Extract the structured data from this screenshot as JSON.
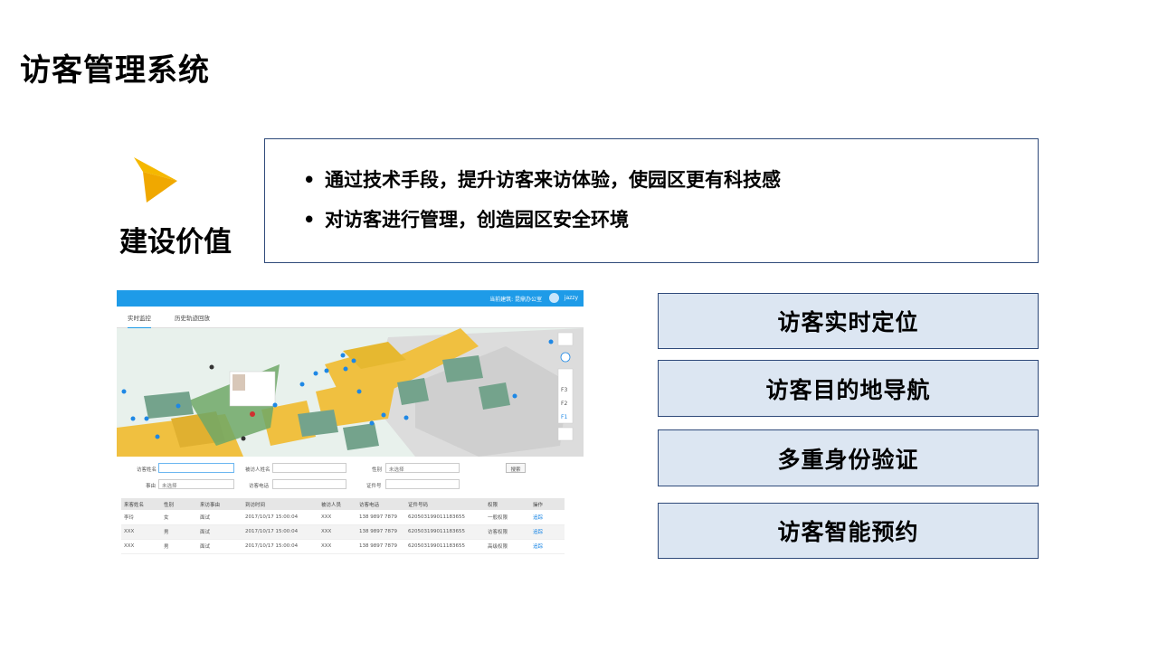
{
  "page": {
    "title": "访客管理系统"
  },
  "value": {
    "heading": "建设价值",
    "bullets": [
      "通过技术手段，提升访客来访体验，使园区更有科技感",
      "对访客进行管理，创造园区安全环境"
    ]
  },
  "features": [
    "访客实时定位",
    "访客目的地导航",
    "多重身份验证",
    "访客智能预约"
  ],
  "colors": {
    "accent": "#1e9be8",
    "feature_bg": "#dce6f2",
    "border": "#2f4a7a",
    "logo": "#f5b800",
    "building": "#f0c040"
  },
  "app": {
    "location": "当前建筑: 昆鼎办公室",
    "user": "jazzy",
    "tabs": [
      "实时监控",
      "历史轨迹回放"
    ],
    "map_controls": [
      "F3",
      "F2",
      "F1"
    ],
    "filters": {
      "visitor_name": "访客姓名",
      "host_name": "被访人姓名",
      "gender": "性别",
      "gender_value": "未选择",
      "reason": "事由",
      "reason_value": "未选择",
      "visitor_phone": "访客电话",
      "id_number": "证件号",
      "search": "搜索"
    },
    "table": {
      "columns": [
        "来客姓名",
        "性别",
        "来访事由",
        "到访时间",
        "被访人员",
        "访客电话",
        "证件号码",
        "权限",
        "操作"
      ],
      "rows": [
        [
          "李玲",
          "女",
          "面试",
          "2017/10/17 15:00:04",
          "XXX",
          "138 9897 7879",
          "620503199011183655",
          "一般权限",
          "追踪"
        ],
        [
          "XXX",
          "男",
          "面试",
          "2017/10/17 15:00:04",
          "XXX",
          "138 9897 7879",
          "620503199011183655",
          "访客权限",
          "追踪"
        ],
        [
          "XXX",
          "男",
          "面试",
          "2017/10/17 15:00:04",
          "XXX",
          "138 9897 7879",
          "620503199011183655",
          "高级权限",
          "追踪"
        ]
      ]
    }
  }
}
